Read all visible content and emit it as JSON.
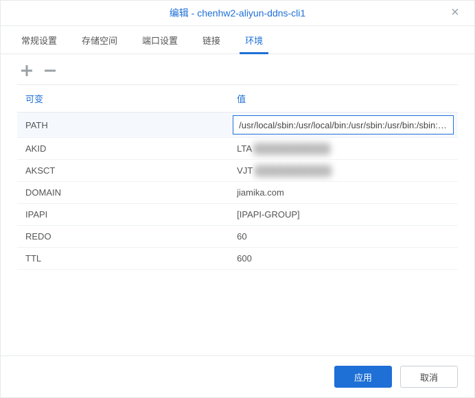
{
  "header": {
    "title": "编辑 - chenhw2-aliyun-ddns-cli1",
    "close_glyph": "×"
  },
  "tabs": [
    {
      "id": "general",
      "label": "常规设置",
      "active": false
    },
    {
      "id": "storage",
      "label": "存储空间",
      "active": false
    },
    {
      "id": "ports",
      "label": "端口设置",
      "active": false
    },
    {
      "id": "links",
      "label": "链接",
      "active": false
    },
    {
      "id": "env",
      "label": "环境",
      "active": true
    }
  ],
  "toolbar": {
    "add_title": "add",
    "remove_title": "remove"
  },
  "table": {
    "headers": {
      "key": "可变",
      "value": "值"
    },
    "rows": [
      {
        "key": "PATH",
        "value": "/usr/local/sbin:/usr/local/bin:/usr/sbin:/usr/bin:/sbin:/bin",
        "selected": true,
        "editing": true
      },
      {
        "key": "AKID",
        "value": "LTA",
        "redacted": true
      },
      {
        "key": "AKSCT",
        "value": "VJT",
        "redacted": true
      },
      {
        "key": "DOMAIN",
        "value": "jiamika.com"
      },
      {
        "key": "IPAPI",
        "value": "[IPAPI-GROUP]"
      },
      {
        "key": "REDO",
        "value": "60"
      },
      {
        "key": "TTL",
        "value": "600"
      }
    ]
  },
  "footer": {
    "apply": "应用",
    "cancel": "取消"
  }
}
